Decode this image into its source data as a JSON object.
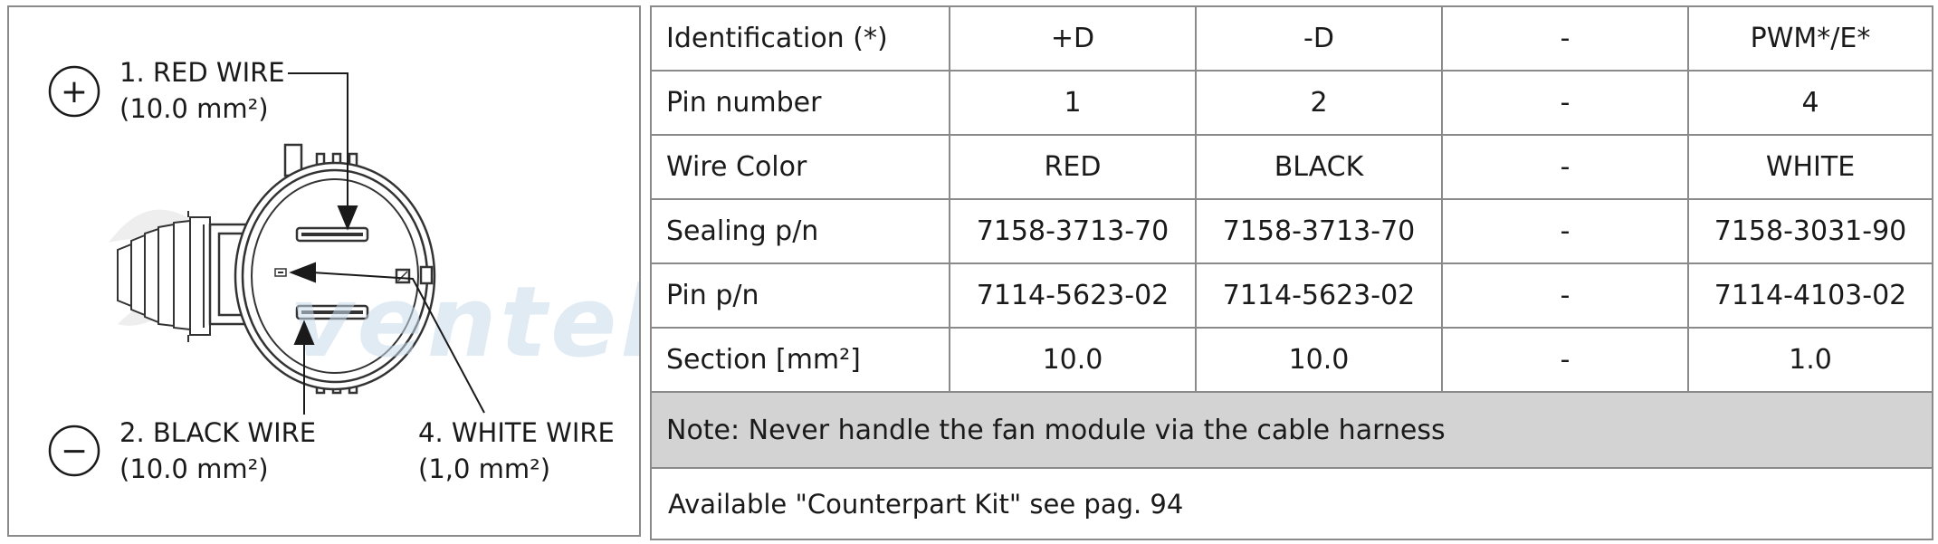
{
  "diagram": {
    "wires": [
      {
        "line1": "1. RED WIRE",
        "line2": "(10.0 mm²)"
      },
      {
        "line1": "2. BLACK WIRE",
        "line2": "(10.0 mm²)"
      },
      {
        "line1": "4. WHITE WIRE",
        "line2": "(1,0 mm²)"
      }
    ],
    "plus_symbol": "+",
    "minus_symbol": "−",
    "icons": [
      "plus-circle-icon",
      "minus-circle-icon",
      "connector-drawing",
      "ventel-watermark"
    ]
  },
  "table": {
    "rows": [
      {
        "param": "Identification (*)",
        "values": [
          "+D",
          "-D",
          "-",
          "PWM*/E*"
        ]
      },
      {
        "param": "Pin number",
        "values": [
          "1",
          "2",
          "-",
          "4"
        ]
      },
      {
        "param": "Wire Color",
        "values": [
          "RED",
          "BLACK",
          "-",
          "WHITE"
        ]
      },
      {
        "param": "Sealing p/n",
        "values": [
          "7158-3713-70",
          "7158-3713-70",
          "-",
          "7158-3031-90"
        ]
      },
      {
        "param": "Pin p/n",
        "values": [
          "7114-5623-02",
          "7114-5623-02",
          "-",
          "7114-4103-02"
        ]
      },
      {
        "param": "Section [mm²]",
        "values": [
          "10.0",
          "10.0",
          "-",
          "1.0"
        ]
      }
    ],
    "note": "Note: Never handle the fan module via the cable harness",
    "kit": "Available \"Counterpart Kit\" see pag. 94"
  },
  "colors": {
    "border": "#8a8a8a",
    "note_background": "#d3d3d3",
    "watermark": "#c9dcec"
  }
}
